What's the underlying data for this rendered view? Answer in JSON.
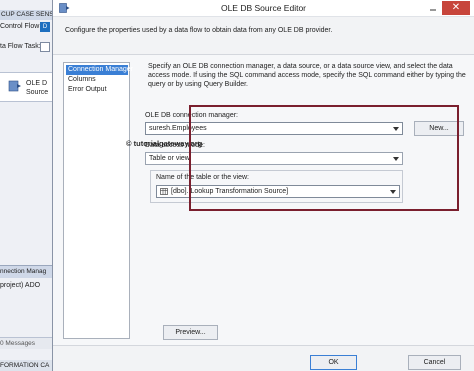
{
  "background": {
    "tab_text": "CUP CASE SENSIT",
    "control_flow_label": "Control Flow",
    "control_flow_badge": "D",
    "data_flow_task_label": "ta Flow Task:",
    "source_line1": "OLE D",
    "source_line2": "Source",
    "connection_managers_label": "nnection Manag",
    "connection_item": "project) ADO",
    "messages_label": "0 Messages",
    "info_text": "FORMATION CA"
  },
  "dialog": {
    "title": "OLE DB Source Editor",
    "close_label": "✕",
    "header_text": "Configure the properties used by a data flow to obtain data from any OLE DB provider.",
    "nav": {
      "items": [
        {
          "label": "Connection Manager"
        },
        {
          "label": "Columns"
        },
        {
          "label": "Error Output"
        }
      ],
      "selected": "Connection Manager"
    },
    "description": "Specify an OLE DB connection manager, a data source, or a data source view, and select the data access mode. If using the SQL command access mode, specify the SQL command either by typing the query or by using Query Builder.",
    "watermark": {
      "symbol": "©",
      "text": "tutorialgateway.org"
    },
    "connection_manager": {
      "label": "OLE DB connection manager:",
      "value": "suresh.Employees",
      "new_button": "New..."
    },
    "access_mode": {
      "label": "Data access mode:",
      "value": "Table or view"
    },
    "table": {
      "label": "Name of the table or the view:",
      "value": "[dbo].[Lookup Transformation Source]"
    },
    "preview_button": "Preview...",
    "ok_button": "OK",
    "cancel_button": "Cancel",
    "accent_color": "#7a1f2e",
    "selection_color": "#3a7fd5"
  }
}
